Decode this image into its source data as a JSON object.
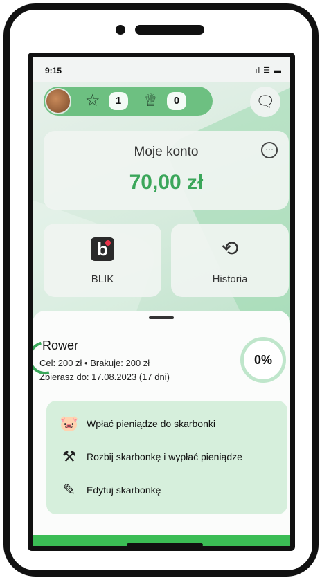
{
  "status": {
    "time": "9:15",
    "icons": "ıl ☰ ▬"
  },
  "header": {
    "stars": "1",
    "trophies": "0"
  },
  "account": {
    "title": "Moje konto",
    "amount": "70,00 zł"
  },
  "tiles": [
    {
      "label": "BLIK",
      "icon": "b"
    },
    {
      "label": "Historia",
      "icon": "history-icon"
    }
  ],
  "goal": {
    "name": "Rower",
    "line1": "Cel: 200 zł • Brakuje: 200 zł",
    "line2": "Zbierasz do: 17.08.2023 (17 dni)",
    "progress": "0%"
  },
  "actions": [
    {
      "label": "Wpłać pieniądze do skarbonki",
      "icon": "piggy-bank-icon"
    },
    {
      "label": "Rozbij skarbonkę i wypłać pieniądze",
      "icon": "hammer-icon"
    },
    {
      "label": "Edytuj skarbonkę",
      "icon": "edit-icon"
    }
  ],
  "colors": {
    "accent": "#3ba65a",
    "pill": "#6dc081",
    "actions_bg": "#d6efdc",
    "bottom_bar": "#3bbd55"
  }
}
